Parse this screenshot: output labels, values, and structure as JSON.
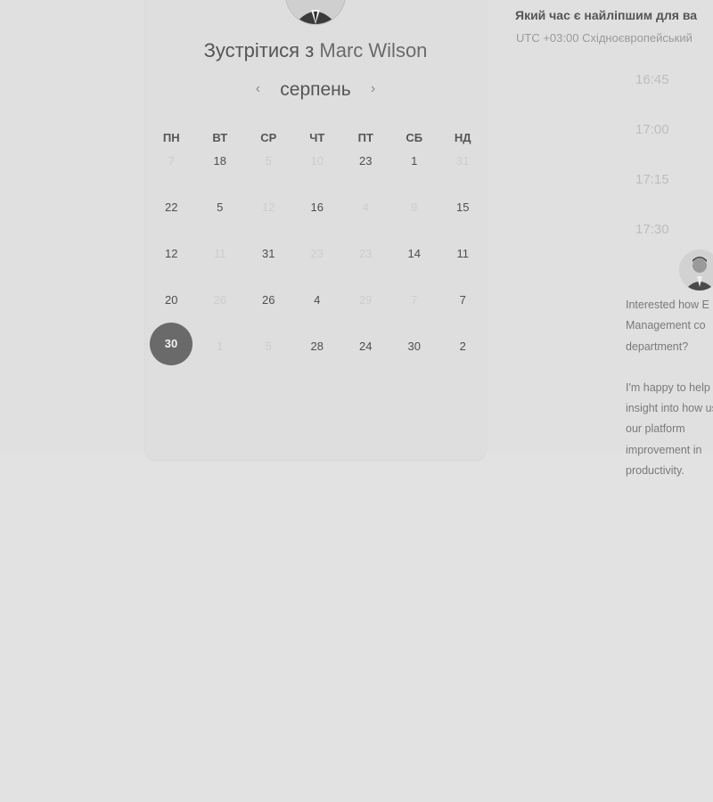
{
  "booking": {
    "title_prefix": "Зустрітися з",
    "host_name": "Marc Wilson",
    "month": "серпень",
    "weekdays": [
      "ПН",
      "ВТ",
      "СР",
      "ЧТ",
      "ПТ",
      "СБ",
      "НД"
    ],
    "weeks": [
      [
        {
          "d": "7",
          "on": false
        },
        {
          "d": "18",
          "on": true
        },
        {
          "d": "5",
          "on": false
        },
        {
          "d": "10",
          "on": false
        },
        {
          "d": "23",
          "on": true
        },
        {
          "d": "1",
          "on": true
        },
        {
          "d": "31",
          "on": false
        }
      ],
      [
        {
          "d": "22",
          "on": true
        },
        {
          "d": "5",
          "on": true
        },
        {
          "d": "12",
          "on": false
        },
        {
          "d": "16",
          "on": true
        },
        {
          "d": "4",
          "on": false
        },
        {
          "d": "9",
          "on": false
        },
        {
          "d": "15",
          "on": true
        }
      ],
      [
        {
          "d": "12",
          "on": true
        },
        {
          "d": "11",
          "on": false
        },
        {
          "d": "31",
          "on": true
        },
        {
          "d": "23",
          "on": false
        },
        {
          "d": "23",
          "on": false
        },
        {
          "d": "14",
          "on": true
        },
        {
          "d": "11",
          "on": true
        }
      ],
      [
        {
          "d": "20",
          "on": true
        },
        {
          "d": "26",
          "on": false
        },
        {
          "d": "26",
          "on": true
        },
        {
          "d": "4",
          "on": true
        },
        {
          "d": "29",
          "on": false
        },
        {
          "d": "7",
          "on": false
        },
        {
          "d": "7",
          "on": true
        }
      ],
      [
        {
          "d": "30",
          "on": true,
          "selected": true
        },
        {
          "d": "1",
          "on": false
        },
        {
          "d": "5",
          "on": false
        },
        {
          "d": "28",
          "on": true
        },
        {
          "d": "24",
          "on": true
        },
        {
          "d": "30",
          "on": true
        },
        {
          "d": "2",
          "on": true
        }
      ]
    ]
  },
  "times": {
    "question": "Який час є найліпшим для ва",
    "timezone": "UTC +03:00 Східноєвропейський",
    "slots": [
      "16:45",
      "17:00",
      "17:15",
      "17:30"
    ]
  },
  "message": {
    "paragraph1": "Interested how E Management co department?",
    "paragraph2": "I'm happy to help insight into how use our platform improvement in productivity."
  }
}
